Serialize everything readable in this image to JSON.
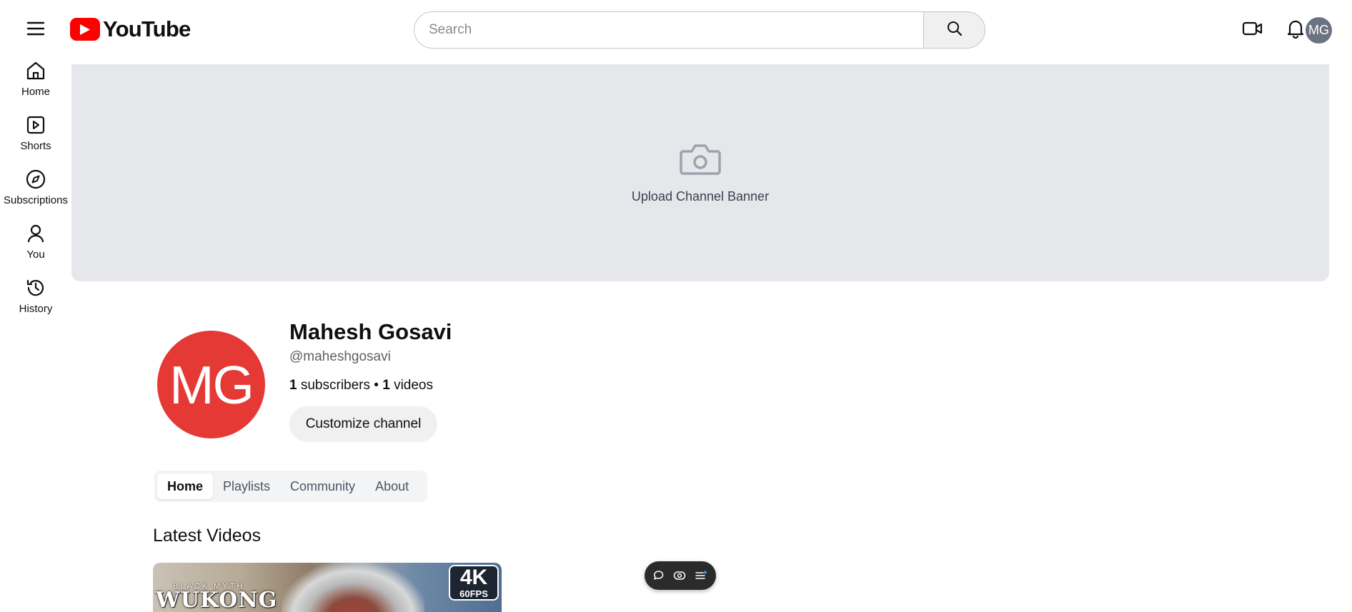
{
  "header": {
    "logo_text": "YouTube",
    "search_placeholder": "Search",
    "search_value": "",
    "avatar_initials": "MG"
  },
  "sidebar": {
    "items": [
      {
        "label": "Home",
        "icon": "home-icon"
      },
      {
        "label": "Shorts",
        "icon": "shorts-icon"
      },
      {
        "label": "Subscriptions",
        "icon": "compass-icon"
      },
      {
        "label": "You",
        "icon": "person-icon"
      },
      {
        "label": "History",
        "icon": "history-icon"
      }
    ]
  },
  "banner": {
    "label": "Upload Channel Banner",
    "icon": "camera-icon"
  },
  "channel": {
    "avatar_initials": "MG",
    "name": "Mahesh Gosavi",
    "handle": "@maheshgosavi",
    "subscriber_count": "1",
    "subscriber_label": " subscribers • ",
    "video_count": "1",
    "video_label": " videos",
    "customize_label": "Customize channel"
  },
  "tabs": [
    {
      "label": "Home",
      "active": true
    },
    {
      "label": "Playlists",
      "active": false
    },
    {
      "label": "Community",
      "active": false
    },
    {
      "label": "About",
      "active": false
    }
  ],
  "latest_videos": {
    "title": "Latest Videos",
    "thumbnail": {
      "game_subtitle": "BLACK MYTH",
      "game_title": "WUKONG",
      "badge_main": "4K",
      "badge_sub": "60FPS"
    }
  },
  "floating_toolbar": {
    "icons": [
      "chat-bubble-icon",
      "eye-icon",
      "list-icon"
    ]
  },
  "colors": {
    "brand_red": "#ff0000",
    "avatar_red": "#e53935",
    "banner_bg": "#e5e7eb",
    "header_avatar": "#6b7280"
  }
}
